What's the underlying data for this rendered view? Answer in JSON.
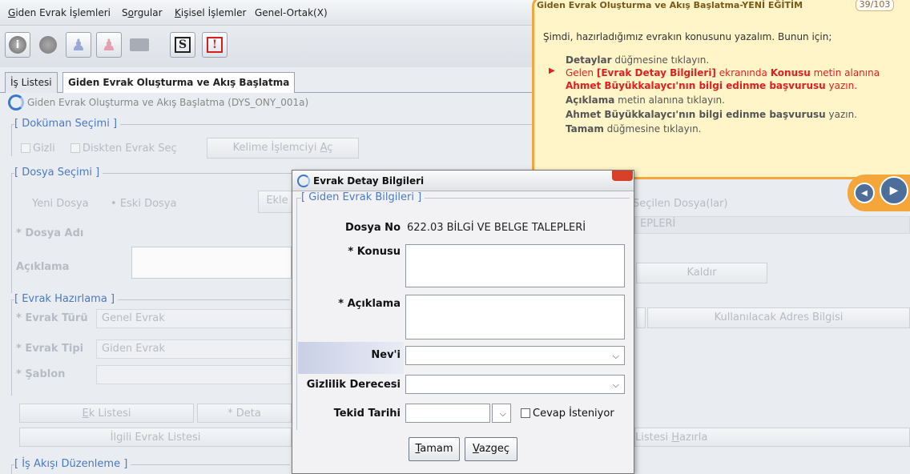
{
  "menu": {
    "items": [
      {
        "pre": "",
        "key": "G",
        "post": "iden Evrak İşlemleri"
      },
      {
        "pre": "S",
        "key": "o",
        "post": "rgular"
      },
      {
        "pre": "",
        "key": "K",
        "post": "işisel İşlemler"
      },
      {
        "pre": "Genel-Ortak(X)",
        "key": "",
        "post": ""
      }
    ]
  },
  "toolbar": {
    "buttons": [
      "info-icon",
      "record-icon",
      "users-icon",
      "users-red-icon",
      "message-icon",
      "s-doc-icon",
      "exclamation-doc-icon"
    ]
  },
  "tabs": {
    "list": "İş Listesi",
    "active": "Giden Evrak Oluşturma ve Akış Başlatma"
  },
  "panel": {
    "title": "Giden Evrak Oluşturma ve Akış Başlatma (DYS_ONY_001a)"
  },
  "doc_selection": {
    "title": "[ Doküman Seçimi ]",
    "gizli": "Gizli",
    "disk_pre": "Diskten Evrak Seç",
    "word_pre": "Kelime İşlemciyi ",
    "word_key": "A",
    "word_post": "ç"
  },
  "file_selection": {
    "title": "[ Dosya Seçimi ]",
    "new_file": "Yeni Dosya",
    "old_file": "Eski Dosya",
    "add": "Ekle",
    "selected": "Seçilen Dosya(lar)",
    "selected_value": "EPLERİ",
    "file_name": "* Dosya Adı",
    "description": "Açıklama",
    "remove": "Kaldır"
  },
  "doc_prep": {
    "title": "[ Evrak Hazırlama ]",
    "type_label": "* Evrak Türü",
    "type_value": "Genel Evrak",
    "kind_label": "* Evrak Tipi",
    "kind_value": "Giden Evrak",
    "template_label": "* Şablon",
    "address": "Kullanılacak Adres Bilgisi",
    "attachments_pre": "",
    "attachments_key": "E",
    "attachments_post": "k Listesi",
    "details": "* Deta",
    "related": "İlgili Evrak Listesi",
    "list_prepare_pre": "Listesi ",
    "list_prepare_key": "H",
    "list_prepare_post": "azırla"
  },
  "workflow": {
    "title": "[ İş Akışı Düzenleme ]"
  },
  "tutorial": {
    "title": "Giden Evrak Oluşturma ve Akış Başlatma-YENİ EĞİTİM",
    "counter": "39/103",
    "intro": "Şimdi, hazırladığımız evrakın konusunu yazalım. Bunun için;",
    "step1_bold": "Detaylar",
    "step1_rest": " düğmesine tıklayın.",
    "step2_a": "Gelen ",
    "step2_b": "[Evrak Detay Bilgileri]",
    "step2_c": " ekranında ",
    "step2_d": "Konusu",
    "step2_e": " metin alanına",
    "step2_line2_bold": "Ahmet Büyükkalaycı'nın bilgi edinme başvurusu",
    "step2_line2_rest": " yazın.",
    "step3_bold": "Açıklama",
    "step3_rest": " metin alanına tıklayın.",
    "step4_bold": "Ahmet Büyükkalaycı'nın bilgi edinme başvurusu",
    "step4_rest": " yazın.",
    "step5_bold": "Tamam",
    "step5_rest": " düğmesine tıklayın.",
    "prev_icon": "previous-icon",
    "next_icon": "next-icon"
  },
  "dialog": {
    "title": "Evrak Detay Bilgileri",
    "group": "[ Giden Evrak Bilgileri ]",
    "file_no_label": "Dosya No",
    "file_no_value": "622.03 BİLGİ VE BELGE TALEPLERİ",
    "subject_label": "* Konusu",
    "subject_value": "",
    "desc_label": "* Açıklama",
    "desc_value": "",
    "nevi_label": "Nev'i",
    "nevi_value": "",
    "secrecy_label": "Gizlilik Derecesi",
    "secrecy_value": "",
    "reminder_label": "Tekid Tarihi",
    "reminder_value": "",
    "reply_label": "Cevap İsteniyor",
    "ok_key": "T",
    "ok_rest": "amam",
    "cancel_key": "V",
    "cancel_rest": "azgeç"
  }
}
